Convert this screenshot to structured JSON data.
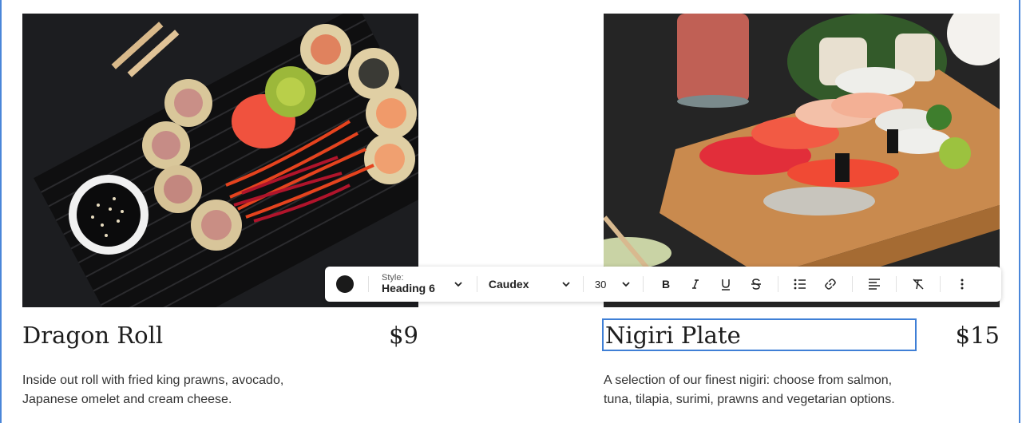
{
  "items": [
    {
      "title": "Dragon Roll",
      "price": "$9",
      "description": "Inside out roll with fried king prawns, avocado, Japanese omelet and cream cheese.",
      "image_subject": "dragon-roll-photo"
    },
    {
      "title": "Nigiri Plate",
      "price": "$15",
      "description": "A selection of our finest nigiri: choose from salmon, tuna, tilapia, surimi, prawns and vegetarian options.",
      "image_subject": "nigiri-plate-photo"
    }
  ],
  "toolbar": {
    "text_color": "#1a1a1a",
    "style_label": "Style:",
    "style_value": "Heading 6",
    "font_value": "Caudex",
    "size_value": "30",
    "icons": [
      "color-swatch-icon",
      "chevron-down-icon",
      "bold-icon",
      "italic-icon",
      "underline-icon",
      "strikethrough-icon",
      "bulleted-list-icon",
      "link-icon",
      "align-left-icon",
      "clear-format-icon",
      "more-options-icon"
    ]
  },
  "colors": {
    "selection_border": "#3f7fd6",
    "frame_border": "#4a86d9"
  }
}
